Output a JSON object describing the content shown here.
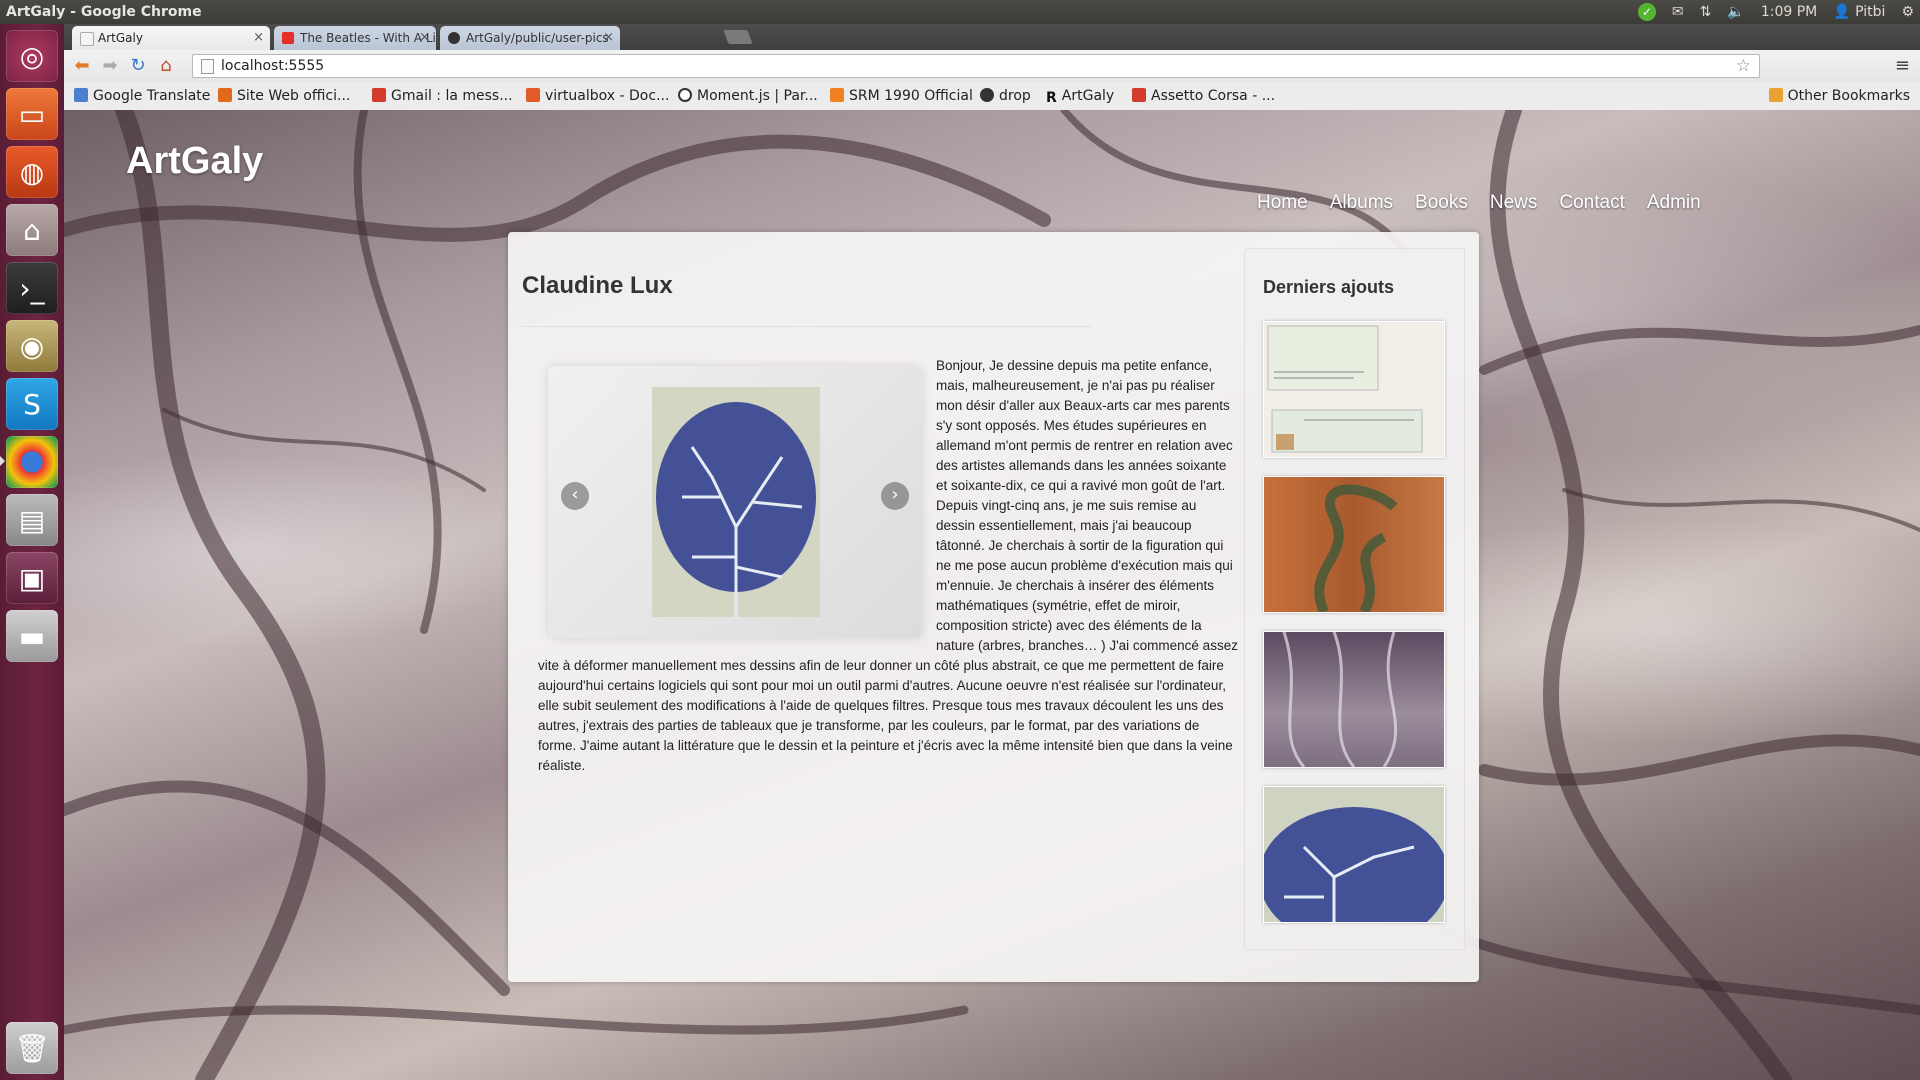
{
  "window_title": "ArtGaly - Google Chrome",
  "panel": {
    "clock": "1:09 PM",
    "user": "Pitbi",
    "icons": [
      "sync-icon",
      "mail-icon",
      "network-icon",
      "volume-icon",
      "gear-icon"
    ]
  },
  "launcher": {
    "items": [
      "ubuntu-dash-icon",
      "files-icon",
      "software-center-icon",
      "store-icon",
      "terminal-icon",
      "speaker-icon",
      "skype-icon",
      "chrome-icon",
      "scanner-icon",
      "workspace-icon",
      "disk-icon",
      "trash-icon"
    ]
  },
  "tabs": [
    {
      "label": "ArtGaly",
      "active": true
    },
    {
      "label": "The Beatles - With A Little",
      "active": false
    },
    {
      "label": "ArtGaly/public/user-pics",
      "active": false
    }
  ],
  "address": {
    "url": "localhost:5555"
  },
  "bookmarks": [
    {
      "label": "Google Translate",
      "color": "#4a7fd0"
    },
    {
      "label": "Site Web offici...",
      "color": "#e06a1a"
    },
    {
      "label": "Gmail : la mess...",
      "color": "#d33c2c"
    },
    {
      "label": "virtualbox - Doc...",
      "color": "#e05a2a"
    },
    {
      "label": "Moment.js | Par...",
      "color": "#333333"
    },
    {
      "label": "SRM 1990 Official",
      "color": "#f08020"
    },
    {
      "label": "drop",
      "color": "#333333"
    },
    {
      "label": "ArtGaly",
      "color": "#111111"
    },
    {
      "label": "Assetto Corsa - ...",
      "color": "#d33c2c"
    }
  ],
  "other_bookmarks": "Other Bookmarks",
  "site": {
    "title": "ArtGaly",
    "nav": [
      "Home",
      "Albums",
      "Books",
      "News",
      "Contact",
      "Admin"
    ],
    "artist_name": "Claudine Lux",
    "bio": "Bonjour, Je dessine depuis ma petite enfance, mais, malheureusement, je n'ai pas pu réaliser mon désir d'aller aux Beaux-arts car mes parents s'y sont opposés. Mes études supérieures en allemand m'ont permis de rentrer en relation avec des artistes allemands dans les années soixante et soixante-dix, ce qui a ravivé mon goût de l'art. Depuis vingt-cinq ans, je me suis remise au dessin essentiellement, mais j'ai beaucoup tâtonné. Je cherchais à sortir de la figuration qui ne me pose aucun problème d'exécution mais qui m'ennuie. Je cherchais à insérer des éléments mathématiques (symétrie, effet de miroir, composition stricte) avec des éléments de la nature (arbres, branches… ) J'ai commencé assez vite à déformer manuellement mes dessins afin de leur donner un côté plus abstrait, ce que me permettent de faire aujourd'hui certains logiciels qui sont pour moi un outil parmi d'autres. Aucune oeuvre n'est réalisée sur l'ordinateur, elle subit seulement des modifications à l'aide de quelques filtres. Presque tous mes travaux découlent les uns des autres, j'extrais des parties de tableaux que je transforme, par les couleurs, par le format, par des variations de forme. J'aime autant la littérature que le dessin et la peinture et j'écris avec la même intensité bien que dans la veine réaliste.",
    "carousel": {
      "prev": "‹",
      "next": "›"
    },
    "sidebar_title": "Derniers ajouts",
    "thumbnails": [
      "id-document",
      "green-abstract",
      "purple-abstract",
      "blue-tree"
    ]
  },
  "colors": {
    "launcher": "#6e2443",
    "panel": "#3c3b37",
    "link": "#ffffff"
  }
}
